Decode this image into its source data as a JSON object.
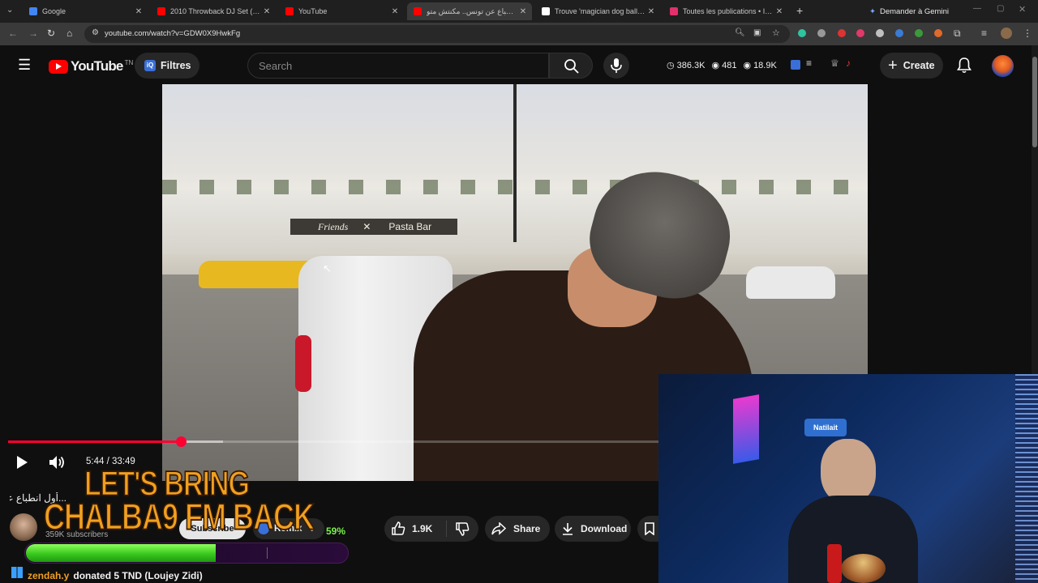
{
  "browser": {
    "tabs": [
      {
        "title": "Google",
        "favicon_color": "#4285f4",
        "active": false
      },
      {
        "title": "2010 Throwback DJ Set (Rihann",
        "favicon_color": "#ff0000",
        "active": false
      },
      {
        "title": "YouTube",
        "favicon_color": "#ff0000",
        "active": false
      },
      {
        "title": "أول انطباع عن تونس.. مكنتش متو",
        "favicon_color": "#ff0000",
        "active": true
      },
      {
        "title": "Trouve 'magician dog ball kid g",
        "favicon_color": "#ffffff",
        "active": false
      },
      {
        "title": "Toutes les publications • Instag",
        "favicon_color": "#e1306c",
        "active": false
      }
    ],
    "new_tab_label": "+",
    "gemini_label": "Demander à Gemini",
    "url": "youtube.com/watch?v=GDW0X9HwkFg"
  },
  "youtube": {
    "logo_text": "YouTube",
    "country_code": "TN",
    "filter_label": "Filtres",
    "search_placeholder": "Search",
    "stats": {
      "views": "386.3K",
      "watching": "481",
      "other": "18.9K"
    },
    "create_label": "Create"
  },
  "player": {
    "time": "5:44 / 33:49",
    "progress_fraction": 0.265,
    "buffer_fraction": 0.33
  },
  "video_scene": {
    "sign_left": "Friends",
    "sign_right": "Pasta Bar"
  },
  "video_info": {
    "title_fragment": "...أول انطباع عن تونس... حصل",
    "subscribers": "359K subscribers",
    "subscribe_label": "Subscribe",
    "remix_label": "Remix",
    "percent": "59%",
    "like_count": "1.9K",
    "share_label": "Share",
    "download_label": "Download"
  },
  "stream_overlay": {
    "headline_line1": "LET'S BRING",
    "headline_line2": "CHALBA9 FM BACK",
    "donation_fraction": 0.59,
    "donation_user": "zendah.y",
    "donation_text": "donated 5 TND (Loujey Zidi)"
  },
  "colors": {
    "accent_red": "#ff0033",
    "donation_green": "#39c81f",
    "overlay_orange": "#f0a020"
  }
}
